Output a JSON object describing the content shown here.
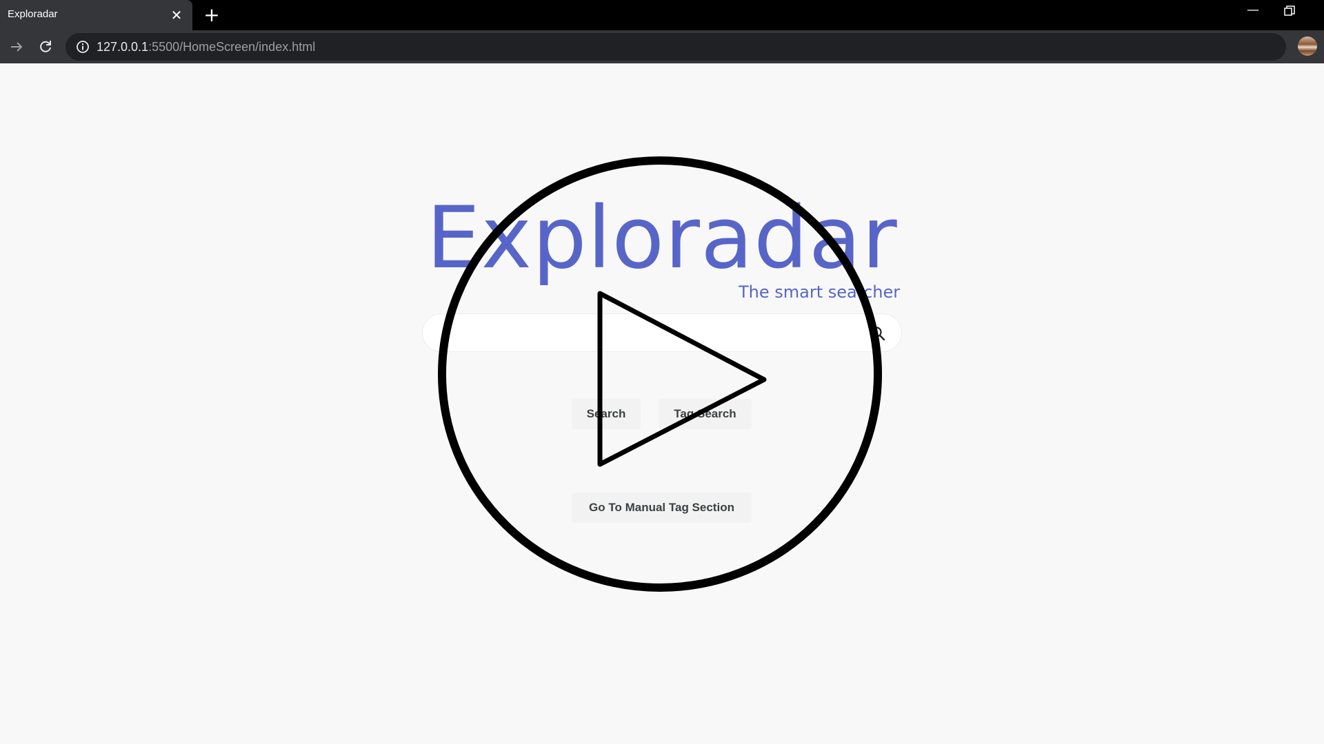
{
  "browser": {
    "tab_title": "Exploradar",
    "tab_close_icon": "close-icon",
    "new_tab_icon": "plus-icon",
    "url_host": "127.0.0.1",
    "url_rest": ":5500/HomeScreen/index.html"
  },
  "page": {
    "logo": "Exploradar",
    "tagline": "The smart searcher",
    "search": {
      "value": "",
      "placeholder": ""
    },
    "buttons": {
      "search": "Search",
      "tag_search": "Tag Search",
      "manual_tag": "Go To Manual Tag Section"
    }
  },
  "overlay": {
    "icon": "play-icon"
  },
  "colors": {
    "brand": "#5865c8",
    "browser_frame": "#000000",
    "toolbar": "#35363a",
    "page_bg": "#f8f8f8"
  }
}
